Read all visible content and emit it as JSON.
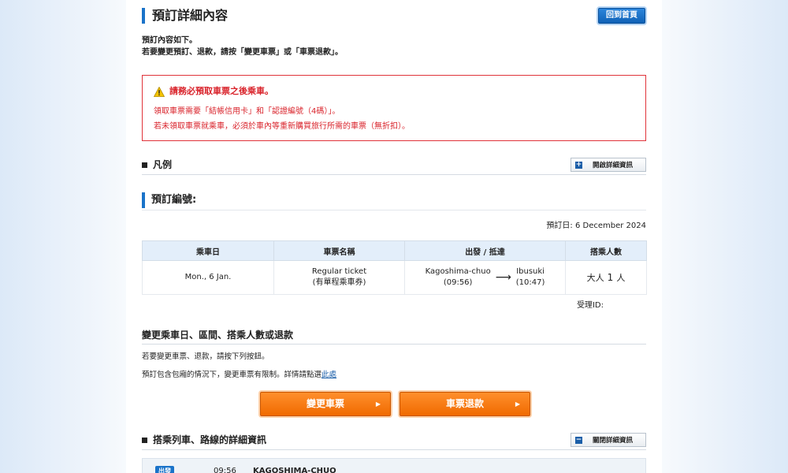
{
  "header": {
    "title": "預訂詳細內容",
    "home_button": "回到首頁"
  },
  "intro": {
    "line1": "預訂內容如下。",
    "line2": "若要變更預訂、退款，請按「變更車票」或「車票退款」。"
  },
  "warning": {
    "title": "請務必預取車票之後乘車。",
    "line1": "領取車票需要「結帳信用卡」和「認證編號（4碼）」。",
    "line2": "若未領取車票就乘車，必須於車內等重新購買旅行所需的車票（無折扣）。"
  },
  "legend": {
    "label": "凡例",
    "button": "開啟詳細資訊"
  },
  "booking": {
    "title": "預訂編號:",
    "date_label": "預訂日: 6 December 2024",
    "accept_label": "受理ID:"
  },
  "ticket_table": {
    "headers": [
      "乘車日",
      "車票名稱",
      "出發 / 抵達",
      "搭乘人數"
    ],
    "row": {
      "date": "Mon., 6 Jan.",
      "ticket_name": "Regular ticket",
      "ticket_sub": "(有單程乘車券)",
      "from_station": "Kagoshima-chuo",
      "from_time": "(09:56)",
      "arrow": "⟶",
      "to_station": "Ibusuki",
      "to_time": "(10:47)",
      "pax_label": "大人",
      "pax_count": "1",
      "pax_unit": "人"
    }
  },
  "change": {
    "title": "變更乘車日、區間、搭乘人數或退款",
    "line1": "若要變更車票、退款，請按下列按鈕。",
    "line2": "預訂包含包廂的情況下，變更車票有限制。詳情請點選",
    "link": "此處",
    "change_button": "變更車票",
    "refund_button": "車票退款"
  },
  "train_details": {
    "label": "搭乘列車、路線的詳細資訊",
    "button": "關閉詳細資訊"
  },
  "train_row": {
    "tag": "出發",
    "time": "09:56",
    "station": "KAGOSHIMA-CHUO"
  },
  "colors": {
    "accent": "#1a73c9",
    "warning": "#d9232b",
    "orange": "#f06a00"
  }
}
